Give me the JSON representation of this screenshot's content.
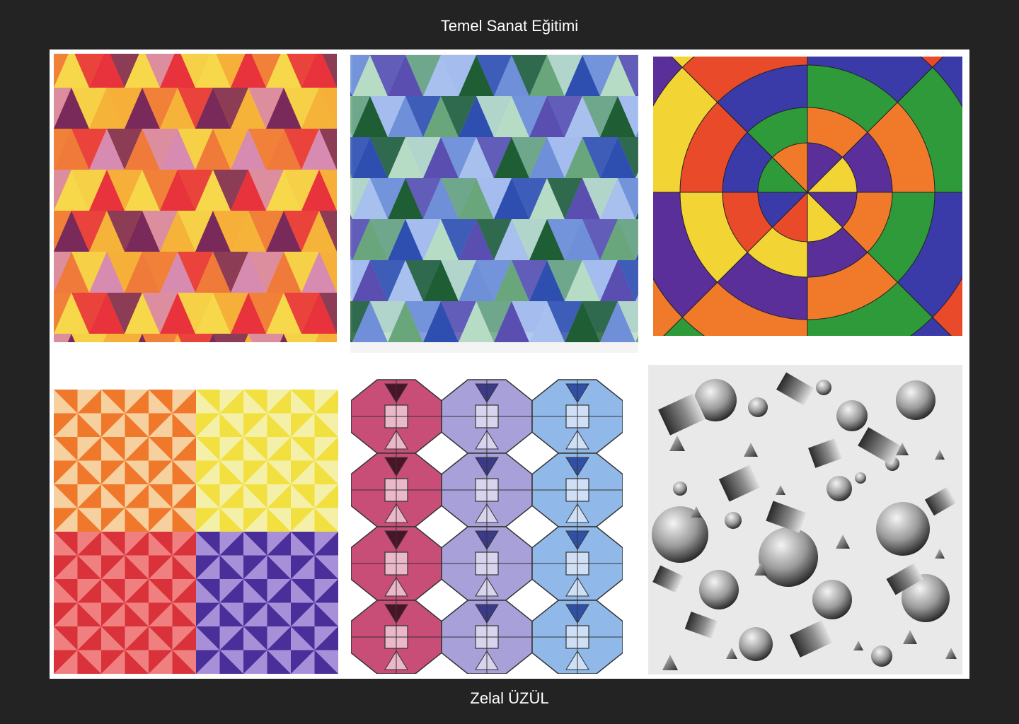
{
  "header": {
    "title": "Temel Sanat Eğitimi"
  },
  "footer": {
    "author": "Zelal ÜZÜL"
  },
  "gallery": {
    "artworks": [
      {
        "subject": "warm triangle tessellation",
        "palette": [
          "#e8323c",
          "#f07a3a",
          "#f6b33a",
          "#f6d84a",
          "#d88bb0",
          "#7a2a5a"
        ]
      },
      {
        "subject": "cool triangle tessellation",
        "palette": [
          "#2f4fb0",
          "#6f8fd8",
          "#a8c0ee",
          "#b7dcc6",
          "#6aa67c",
          "#1f5e34",
          "#5a4fb0"
        ]
      },
      {
        "subject": "concentric rings color wheel",
        "palette": [
          "#f2d535",
          "#e84a2a",
          "#3a3aa8",
          "#2f9a3a",
          "#f07a2a",
          "#5a2f9a"
        ]
      },
      {
        "subject": "pinwheel triangle quadrants",
        "palette": [
          "#f0782a",
          "#f7d0a0",
          "#f2e040",
          "#f4f0a8",
          "#d9323a",
          "#f08080",
          "#4a2f9a",
          "#a890d8"
        ]
      },
      {
        "subject": "octagon square pattern gradient",
        "palette": [
          "#4a1428",
          "#c84e78",
          "#eab8c8",
          "#3a3a8a",
          "#a8a0d8",
          "#3050a8",
          "#90b8e8"
        ]
      },
      {
        "subject": "pencil shaded geometric solids",
        "palette": [
          "#1a1a1a",
          "#7a7a7a",
          "#e8e8e8"
        ]
      }
    ]
  }
}
